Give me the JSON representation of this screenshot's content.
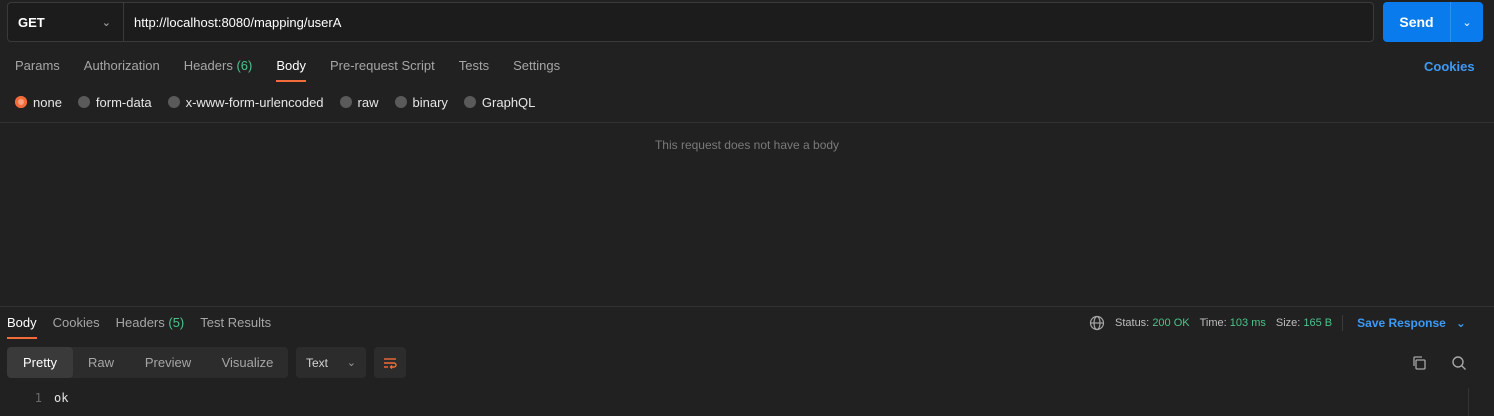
{
  "request": {
    "method": "GET",
    "url": "http://localhost:8080/mapping/userA",
    "send_label": "Send"
  },
  "request_tabs": [
    {
      "label": "Params"
    },
    {
      "label": "Authorization"
    },
    {
      "label": "Headers",
      "count": "(6)"
    },
    {
      "label": "Body"
    },
    {
      "label": "Pre-request Script"
    },
    {
      "label": "Tests"
    },
    {
      "label": "Settings"
    }
  ],
  "cookies_label": "Cookies",
  "body_types": [
    "none",
    "form-data",
    "x-www-form-urlencoded",
    "raw",
    "binary",
    "GraphQL"
  ],
  "empty_body_text": "This request does not have a body",
  "response": {
    "tabs": [
      {
        "label": "Body"
      },
      {
        "label": "Cookies"
      },
      {
        "label": "Headers",
        "count": "(5)"
      },
      {
        "label": "Test Results"
      }
    ],
    "status_label": "Status:",
    "status_value": "200 OK",
    "time_label": "Time:",
    "time_value": "103 ms",
    "size_label": "Size:",
    "size_value": "165 B",
    "save_label": "Save Response",
    "views": [
      "Pretty",
      "Raw",
      "Preview",
      "Visualize"
    ],
    "format": "Text",
    "lines": [
      {
        "num": "1",
        "text": "ok"
      }
    ]
  },
  "colors": {
    "accent": "#f26b3a",
    "primary": "#097bed",
    "link": "#3d9af5",
    "success": "#4cc38a",
    "background": "#212121"
  }
}
